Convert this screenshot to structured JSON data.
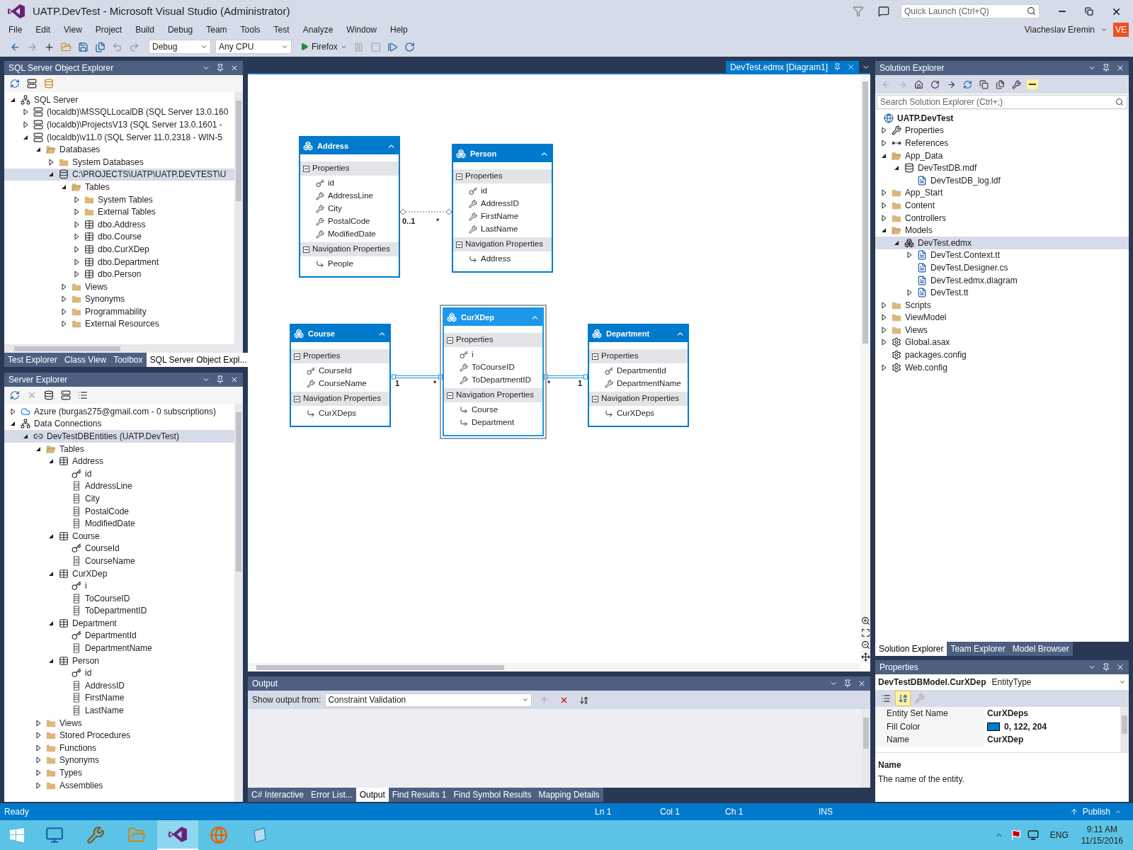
{
  "window": {
    "title": "UATP.DevTest - Microsoft Visual Studio (Administrator)",
    "quick_launch_placeholder": "Quick Launch (Ctrl+Q)",
    "user_name": "Viacheslav Eremin",
    "user_initials": "VE"
  },
  "menu": [
    "File",
    "Edit",
    "View",
    "Project",
    "Build",
    "Debug",
    "Team",
    "Tools",
    "Test",
    "Analyze",
    "Window",
    "Help"
  ],
  "toolbar": {
    "configuration": "Debug",
    "platform": "Any CPU",
    "run_target": "Firefox"
  },
  "sql_explorer": {
    "title": "SQL Server Object Explorer",
    "tree": [
      {
        "label": "SQL Server",
        "kind": "connections",
        "expanded": true,
        "selected": false,
        "children": [
          {
            "label": "(localdb)\\MSSQLLocalDB (SQL Server 13.0.160",
            "kind": "server",
            "expanded": false,
            "selected": false
          },
          {
            "label": "(localdb)\\ProjectsV13 (SQL Server 13.0.1601 -",
            "kind": "server",
            "expanded": false,
            "selected": false
          },
          {
            "label": "(localdb)\\v11.0 (SQL Server 11.0.2318 - WIN-5",
            "kind": "server",
            "expanded": true,
            "selected": false,
            "children": [
              {
                "label": "Databases",
                "kind": "folder_open",
                "expanded": true,
                "selected": false,
                "children": [
                  {
                    "label": "System Databases",
                    "kind": "folder",
                    "expanded": false,
                    "selected": false
                  },
                  {
                    "label": "C:\\PROJECTS\\UATP\\UATP.DEVTEST\\U",
                    "kind": "database",
                    "expanded": true,
                    "selected": true,
                    "children": [
                      {
                        "label": "Tables",
                        "kind": "folder_open",
                        "expanded": true,
                        "selected": false,
                        "children": [
                          {
                            "label": "System Tables",
                            "kind": "folder",
                            "expanded": false,
                            "selected": false
                          },
                          {
                            "label": "External Tables",
                            "kind": "folder",
                            "expanded": false,
                            "selected": false
                          },
                          {
                            "label": "dbo.Address",
                            "kind": "table",
                            "expanded": false,
                            "selected": false
                          },
                          {
                            "label": "dbo.Course",
                            "kind": "table",
                            "expanded": false,
                            "selected": false
                          },
                          {
                            "label": "dbo.CurXDep",
                            "kind": "table",
                            "expanded": false,
                            "selected": false
                          },
                          {
                            "label": "dbo.Department",
                            "kind": "table",
                            "expanded": false,
                            "selected": false
                          },
                          {
                            "label": "dbo.Person",
                            "kind": "table",
                            "expanded": false,
                            "selected": false
                          }
                        ]
                      },
                      {
                        "label": "Views",
                        "kind": "folder",
                        "expanded": false,
                        "selected": false
                      },
                      {
                        "label": "Synonyms",
                        "kind": "folder",
                        "expanded": false,
                        "selected": false
                      },
                      {
                        "label": "Programmability",
                        "kind": "folder",
                        "expanded": false,
                        "selected": false
                      },
                      {
                        "label": "External Resources",
                        "kind": "folder",
                        "expanded": false,
                        "selected": false
                      }
                    ]
                  }
                ]
              }
            ]
          }
        ]
      }
    ]
  },
  "left_tabs": [
    {
      "label": "Test Explorer",
      "selected": false
    },
    {
      "label": "Class View",
      "selected": false
    },
    {
      "label": "Toolbox",
      "selected": false
    },
    {
      "label": "SQL Server Object Expl...",
      "selected": true
    }
  ],
  "server_explorer": {
    "title": "Server Explorer",
    "tree": [
      {
        "label": "Azure (burgas275@gmail.com - 0 subscriptions)",
        "kind": "cloud",
        "expanded": false,
        "selected": false
      },
      {
        "label": "Data Connections",
        "kind": "connections",
        "expanded": true,
        "selected": false,
        "children": [
          {
            "label": "DevTestDBEntities (UATP.DevTest)",
            "kind": "connection",
            "expanded": true,
            "selected": true,
            "children": [
              {
                "label": "Tables",
                "kind": "folder_open",
                "expanded": true,
                "selected": false,
                "children": [
                  {
                    "label": "Address",
                    "kind": "table",
                    "expanded": true,
                    "selected": false,
                    "children": [
                      {
                        "label": "id",
                        "kind": "key",
                        "selected": false
                      },
                      {
                        "label": "AddressLine",
                        "kind": "column",
                        "selected": false
                      },
                      {
                        "label": "City",
                        "kind": "column",
                        "selected": false
                      },
                      {
                        "label": "PostalCode",
                        "kind": "column",
                        "selected": false
                      },
                      {
                        "label": "ModifiedDate",
                        "kind": "column",
                        "selected": false
                      }
                    ]
                  },
                  {
                    "label": "Course",
                    "kind": "table",
                    "expanded": true,
                    "selected": false,
                    "children": [
                      {
                        "label": "CourseId",
                        "kind": "key",
                        "selected": false
                      },
                      {
                        "label": "CourseName",
                        "kind": "column",
                        "selected": false
                      }
                    ]
                  },
                  {
                    "label": "CurXDep",
                    "kind": "table",
                    "expanded": true,
                    "selected": false,
                    "children": [
                      {
                        "label": "i",
                        "kind": "key",
                        "selected": false
                      },
                      {
                        "label": "ToCourseID",
                        "kind": "column",
                        "selected": false
                      },
                      {
                        "label": "ToDepartmentID",
                        "kind": "column",
                        "selected": false
                      }
                    ]
                  },
                  {
                    "label": "Department",
                    "kind": "table",
                    "expanded": true,
                    "selected": false,
                    "children": [
                      {
                        "label": "DepartmentId",
                        "kind": "key",
                        "selected": false
                      },
                      {
                        "label": "DepartmentName",
                        "kind": "column",
                        "selected": false
                      }
                    ]
                  },
                  {
                    "label": "Person",
                    "kind": "table",
                    "expanded": true,
                    "selected": false,
                    "children": [
                      {
                        "label": "id",
                        "kind": "key",
                        "selected": false
                      },
                      {
                        "label": "AddressID",
                        "kind": "column",
                        "selected": false
                      },
                      {
                        "label": "FirstName",
                        "kind": "column",
                        "selected": false
                      },
                      {
                        "label": "LastName",
                        "kind": "column",
                        "selected": false
                      }
                    ]
                  }
                ]
              },
              {
                "label": "Views",
                "kind": "folder",
                "expanded": false,
                "selected": false
              },
              {
                "label": "Stored Procedures",
                "kind": "folder",
                "expanded": false,
                "selected": false
              },
              {
                "label": "Functions",
                "kind": "folder",
                "expanded": false,
                "selected": false
              },
              {
                "label": "Synonyms",
                "kind": "folder",
                "expanded": false,
                "selected": false
              },
              {
                "label": "Types",
                "kind": "folder",
                "expanded": false,
                "selected": false
              },
              {
                "label": "Assemblies",
                "kind": "folder",
                "expanded": false,
                "selected": false
              }
            ]
          }
        ]
      }
    ]
  },
  "document_tab": {
    "title": "DevTest.edmx [Diagram1]"
  },
  "diagram": {
    "entities": [
      {
        "name": "Address",
        "selected": false,
        "sections": [
          {
            "title": "Properties",
            "items": [
              {
                "name": "id",
                "kind": "key"
              },
              {
                "name": "AddressLine",
                "kind": "property"
              },
              {
                "name": "City",
                "kind": "property"
              },
              {
                "name": "PostalCode",
                "kind": "property"
              },
              {
                "name": "ModifiedDate",
                "kind": "property"
              }
            ]
          },
          {
            "title": "Navigation Properties",
            "items": [
              {
                "name": "People",
                "kind": "navigation"
              }
            ]
          }
        ]
      },
      {
        "name": "Person",
        "selected": false,
        "sections": [
          {
            "title": "Properties",
            "items": [
              {
                "name": "id",
                "kind": "key"
              },
              {
                "name": "AddressID",
                "kind": "property"
              },
              {
                "name": "FirstName",
                "kind": "property"
              },
              {
                "name": "LastName",
                "kind": "property"
              }
            ]
          },
          {
            "title": "Navigation Properties",
            "items": [
              {
                "name": "Address",
                "kind": "navigation"
              }
            ]
          }
        ]
      },
      {
        "name": "Course",
        "selected": false,
        "sections": [
          {
            "title": "Properties",
            "items": [
              {
                "name": "CourseId",
                "kind": "key"
              },
              {
                "name": "CourseName",
                "kind": "property"
              }
            ]
          },
          {
            "title": "Navigation Properties",
            "items": [
              {
                "name": "CurXDeps",
                "kind": "navigation"
              }
            ]
          }
        ]
      },
      {
        "name": "CurXDep",
        "selected": true,
        "sections": [
          {
            "title": "Properties",
            "items": [
              {
                "name": "i",
                "kind": "key"
              },
              {
                "name": "ToCourseID",
                "kind": "property"
              },
              {
                "name": "ToDepartmentID",
                "kind": "property"
              }
            ]
          },
          {
            "title": "Navigation Properties",
            "items": [
              {
                "name": "Course",
                "kind": "navigation"
              },
              {
                "name": "Department",
                "kind": "navigation"
              }
            ]
          }
        ]
      },
      {
        "name": "Department",
        "selected": false,
        "sections": [
          {
            "title": "Properties",
            "items": [
              {
                "name": "DepartmentId",
                "kind": "key"
              },
              {
                "name": "DepartmentName",
                "kind": "property"
              }
            ]
          },
          {
            "title": "Navigation Properties",
            "items": [
              {
                "name": "CurXDeps",
                "kind": "navigation"
              }
            ]
          }
        ]
      }
    ],
    "associations": [
      {
        "source_label": "0..1",
        "target_label": "*",
        "highlighted": false
      },
      {
        "source_label": "1",
        "target_label": "*",
        "highlighted": true
      },
      {
        "source_label": "*",
        "target_label": "1",
        "highlighted": true
      }
    ]
  },
  "output": {
    "title": "Output",
    "show_label": "Show output from:",
    "source": "Constraint Validation",
    "tabs": [
      {
        "label": "C# Interactive",
        "selected": false
      },
      {
        "label": "Error List...",
        "selected": false
      },
      {
        "label": "Output",
        "selected": true
      },
      {
        "label": "Find Results 1",
        "selected": false
      },
      {
        "label": "Find Symbol Results",
        "selected": false
      },
      {
        "label": "Mapping Details",
        "selected": false
      }
    ]
  },
  "solution_explorer": {
    "title": "Solution Explorer",
    "search_placeholder": "Search Solution Explorer (Ctrl+;)",
    "project": {
      "label": "UATP.DevTest",
      "children": [
        {
          "label": "Properties",
          "kind": "wrench",
          "expanded": false,
          "selected": false
        },
        {
          "label": "References",
          "kind": "references",
          "expanded": false,
          "selected": false
        },
        {
          "label": "App_Data",
          "kind": "folder_open",
          "expanded": true,
          "selected": false,
          "children": [
            {
              "label": "DevTestDB.mdf",
              "kind": "database",
              "expanded": true,
              "selected": false,
              "children": [
                {
                  "label": "DevTestDB_log.ldf",
                  "kind": "file",
                  "selected": false
                }
              ]
            }
          ]
        },
        {
          "label": "App_Start",
          "kind": "folder",
          "expanded": false,
          "selected": false
        },
        {
          "label": "Content",
          "kind": "folder",
          "expanded": false,
          "selected": false
        },
        {
          "label": "Controllers",
          "kind": "folder",
          "expanded": false,
          "selected": false
        },
        {
          "label": "Models",
          "kind": "folder_open",
          "expanded": true,
          "selected": false,
          "children": [
            {
              "label": "DevTest.edmx",
              "kind": "model",
              "expanded": true,
              "selected": true,
              "children": [
                {
                  "label": "DevTest.Context.tt",
                  "kind": "file",
                  "expanded": false,
                  "selected": false
                },
                {
                  "label": "DevTest.Designer.cs",
                  "kind": "file",
                  "selected": false
                },
                {
                  "label": "DevTest.edmx.diagram",
                  "kind": "file",
                  "selected": false
                },
                {
                  "label": "DevTest.tt",
                  "kind": "file",
                  "expanded": false,
                  "selected": false
                }
              ]
            }
          ]
        },
        {
          "label": "Scripts",
          "kind": "folder",
          "expanded": false,
          "selected": false
        },
        {
          "label": "ViewModel",
          "kind": "folder",
          "expanded": false,
          "selected": false
        },
        {
          "label": "Views",
          "kind": "folder",
          "expanded": false,
          "selected": false
        },
        {
          "label": "Global.asax",
          "kind": "config",
          "expanded": false,
          "selected": false
        },
        {
          "label": "packages.config",
          "kind": "config",
          "selected": false
        },
        {
          "label": "Web.config",
          "kind": "config",
          "expanded": false,
          "selected": false
        }
      ]
    }
  },
  "right_tabs": [
    {
      "label": "Solution Explorer",
      "selected": true
    },
    {
      "label": "Team Explorer",
      "selected": false
    },
    {
      "label": "Model Browser",
      "selected": false
    }
  ],
  "properties": {
    "title": "Properties",
    "object_name": "DevTestDBModel.CurXDep",
    "object_type": "EntityType",
    "rows": [
      {
        "name": "Entity Set Name",
        "value": "CurXDeps"
      },
      {
        "name": "Fill Color",
        "value": "0, 122, 204",
        "color": "#007acc"
      },
      {
        "name": "Name",
        "value": "CurXDep"
      }
    ],
    "description_title": "Name",
    "description": "The name of the entity."
  },
  "status_bar": {
    "text": "Ready",
    "ln": "Ln 1",
    "col": "Col 1",
    "ch": "Ch 1",
    "mode": "INS",
    "publish": "Publish"
  },
  "taskbar": {
    "language": "ENG",
    "time": "9:11 AM",
    "date": "11/15/2016"
  }
}
